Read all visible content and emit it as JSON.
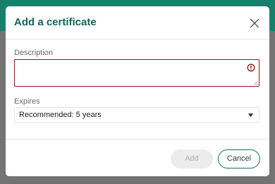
{
  "dialog": {
    "title": "Add a certificate"
  },
  "description": {
    "label": "Description",
    "value": "",
    "error_color": "#8b1a1a"
  },
  "expires": {
    "label": "Expires",
    "selected": "Recommended: 5 years"
  },
  "buttons": {
    "add_label": "Add",
    "cancel_label": "Cancel"
  },
  "icons": {
    "close": "close-icon",
    "error": "error-icon",
    "dropdown": "caret-down-icon"
  },
  "colors": {
    "brand": "#17806b",
    "title": "#11665a",
    "error": "#8b1a1a",
    "disabled_button": "#ececec"
  }
}
